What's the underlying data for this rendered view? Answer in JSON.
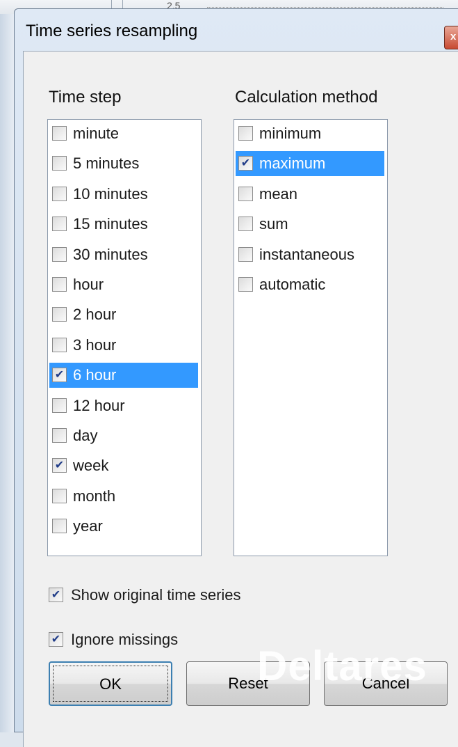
{
  "background": {
    "tick_label": "2.5"
  },
  "dialog": {
    "title": "Time series resampling",
    "close_glyph": "x"
  },
  "time_step": {
    "label": "Time step",
    "items": [
      {
        "label": "minute",
        "checked": false,
        "selected": false
      },
      {
        "label": "5 minutes",
        "checked": false,
        "selected": false
      },
      {
        "label": "10 minutes",
        "checked": false,
        "selected": false
      },
      {
        "label": "15 minutes",
        "checked": false,
        "selected": false
      },
      {
        "label": "30 minutes",
        "checked": false,
        "selected": false
      },
      {
        "label": "hour",
        "checked": false,
        "selected": false
      },
      {
        "label": "2 hour",
        "checked": false,
        "selected": false
      },
      {
        "label": "3 hour",
        "checked": false,
        "selected": false
      },
      {
        "label": "6 hour",
        "checked": true,
        "selected": true
      },
      {
        "label": "12 hour",
        "checked": false,
        "selected": false
      },
      {
        "label": "day",
        "checked": false,
        "selected": false
      },
      {
        "label": "week",
        "checked": true,
        "selected": false
      },
      {
        "label": "month",
        "checked": false,
        "selected": false
      },
      {
        "label": "year",
        "checked": false,
        "selected": false
      }
    ]
  },
  "calculation_method": {
    "label": "Calculation method",
    "items": [
      {
        "label": "minimum",
        "checked": false,
        "selected": false
      },
      {
        "label": "maximum",
        "checked": true,
        "selected": true
      },
      {
        "label": "mean",
        "checked": false,
        "selected": false
      },
      {
        "label": "sum",
        "checked": false,
        "selected": false
      },
      {
        "label": "instantaneous",
        "checked": false,
        "selected": false
      },
      {
        "label": "automatic",
        "checked": false,
        "selected": false
      }
    ]
  },
  "options": {
    "show_original": {
      "label": "Show original time series",
      "checked": true
    },
    "ignore_missings": {
      "label": "Ignore missings",
      "checked": true
    }
  },
  "buttons": {
    "ok": "OK",
    "reset": "Reset",
    "cancel": "Cancel"
  },
  "watermark": "Deltares",
  "colors": {
    "selection": "#3399ff",
    "check_mark": "#203c88"
  }
}
